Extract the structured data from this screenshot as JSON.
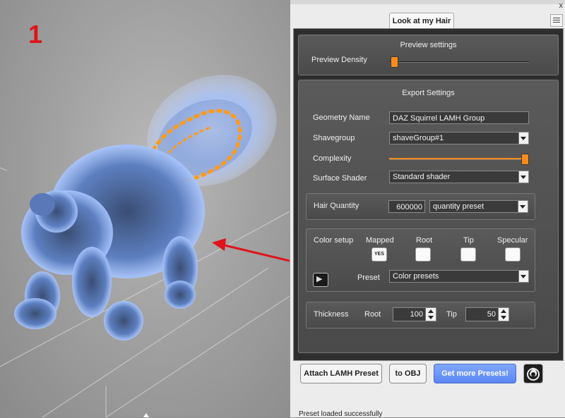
{
  "viewport": {
    "label": "1"
  },
  "panel": {
    "tab_title": "Look at my Hair",
    "close_glyph": "x",
    "preview": {
      "title": "Preview settings",
      "density_label": "Preview Density",
      "density_level": 0.02
    },
    "export": {
      "title": "Export Settings",
      "geometry_name_label": "Geometry Name",
      "geometry_name_value": "DAZ Squirrel LAMH Group",
      "shavegroup_label": "Shavegroup",
      "shavegroup_value": "shaveGroup#1",
      "complexity_label": "Complexity",
      "complexity_level": 1.0,
      "surface_shader_label": "Surface Shader",
      "surface_shader_value": "Standard shader"
    },
    "hair_quantity": {
      "label": "Hair Quantity",
      "value": "600000",
      "preset_value": "quantity preset"
    },
    "color_setup": {
      "title": "Color setup",
      "mapped_label": "Mapped",
      "mapped_value": "YES",
      "root_label": "Root",
      "tip_label": "Tip",
      "specular_label": "Specular",
      "preset_label": "Preset",
      "preset_value": "Color presets"
    },
    "thickness": {
      "label": "Thickness",
      "root_label": "Root",
      "root_value": "100",
      "tip_label": "Tip",
      "tip_value": "50"
    },
    "buttons": {
      "attach": "Attach LAMH Preset",
      "to_obj": "to OBJ",
      "get_more": "Get more Presets!"
    },
    "status": "Preset loaded successfully"
  },
  "colors": {
    "accent": "#ff8c1a",
    "hair_blue": "#8fb8ff",
    "arrow_red": "#e0141b",
    "button_blue": "#6b95f8"
  }
}
